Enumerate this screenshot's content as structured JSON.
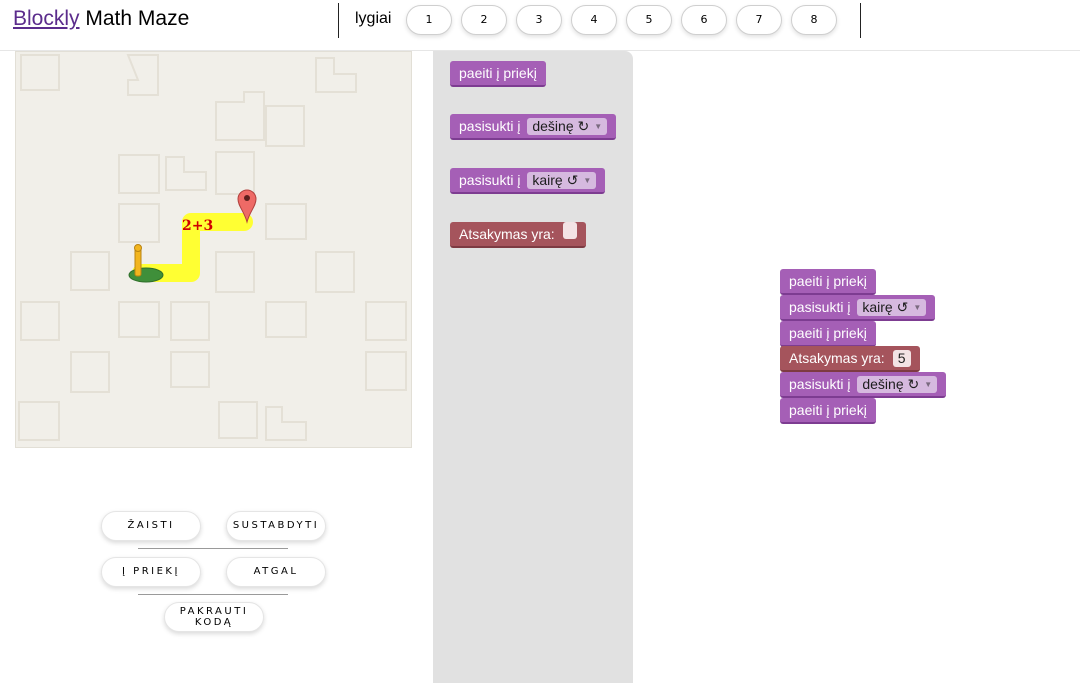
{
  "header": {
    "title_link": "Blockly",
    "title_rest": "Math Maze",
    "levels_label": "lygiai",
    "levels": [
      "1",
      "2",
      "3",
      "4",
      "5",
      "6",
      "7",
      "8"
    ]
  },
  "maze": {
    "expression": "2+3"
  },
  "controls": {
    "play": "ŽAISTI",
    "stop": "SUSTABDYTI",
    "forward": "Į PRIEKĮ",
    "back": "ATGAL",
    "load_line1": "PAKRAUTI",
    "load_line2": "KODĄ"
  },
  "toolbox": {
    "move_forward": "paeiti į priekį",
    "turn_prefix": "pasisukti į",
    "turn_right": "dešinę ↻",
    "turn_left": "kairę ↺",
    "answer_label": "Atsakymas yra:"
  },
  "workspace": {
    "blocks": [
      {
        "text": "paeiti į priekį"
      },
      {
        "text": "pasisukti į",
        "option": "kairę ↺"
      },
      {
        "text": "paeiti į priekį"
      },
      {
        "text": "Atsakymas yra:",
        "value": "5"
      },
      {
        "text": "pasisukti į",
        "option": "dešinę ↻"
      },
      {
        "text": "paeiti į priekį"
      }
    ]
  },
  "colors": {
    "motion_block": "#a55fb6",
    "answer_block": "#a5545c",
    "path": "#ffff33",
    "maze_bg": "#f1efe9",
    "toolbox_bg": "#e1e1e1",
    "expression": "#d00000"
  }
}
